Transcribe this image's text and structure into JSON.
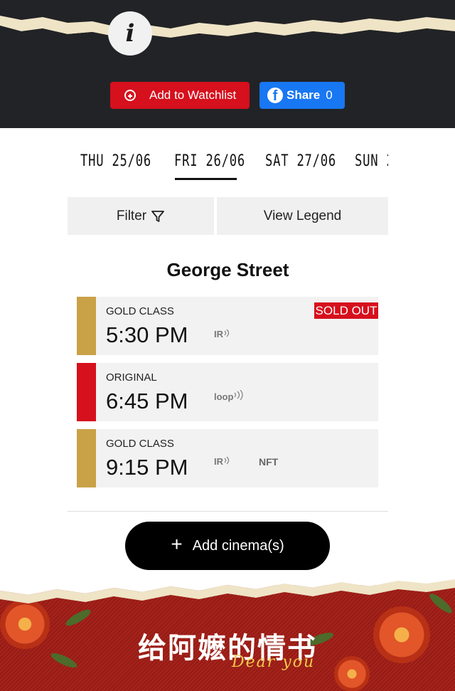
{
  "header": {
    "info_glyph": "i",
    "watchlist_label": "Add to Watchlist",
    "share_label": "Share",
    "share_count": "0"
  },
  "dates": [
    {
      "label": "THU 25/06",
      "selected": false
    },
    {
      "label": "FRI 26/06",
      "selected": true
    },
    {
      "label": "SAT 27/06",
      "selected": false
    },
    {
      "label": "SUN 2",
      "selected": false
    }
  ],
  "controls": {
    "filter_label": "Filter",
    "legend_label": "View Legend"
  },
  "cinema": {
    "name": "George Street",
    "sessions": [
      {
        "class": "GOLD CLASS",
        "time": "5:30 PM",
        "feature": "IR",
        "feature2": "",
        "badge": "SOLD OUT",
        "stripe_color": "#c9a247"
      },
      {
        "class": "ORIGINAL",
        "time": "6:45 PM",
        "feature": "loop",
        "feature2": "",
        "badge": "",
        "stripe_color": "#d6101d"
      },
      {
        "class": "GOLD CLASS",
        "time": "9:15 PM",
        "feature": "IR",
        "feature2": "NFT",
        "badge": "",
        "stripe_color": "#c9a247"
      }
    ]
  },
  "add_cinema": {
    "icon": "+",
    "label": "Add cinema(s)"
  },
  "caption": {
    "chinese": "给阿嬷的情书",
    "english": "Dear you"
  },
  "colors": {
    "accent_red": "#d6101d",
    "facebook_blue": "#1877f2",
    "gold": "#c9a247",
    "header_dark": "#222326",
    "banner_red": "#a21d16"
  },
  "icons": {
    "info": "info-icon",
    "watchlist": "plus-circle-icon",
    "share": "facebook-icon",
    "filter": "funnel-icon",
    "add": "plus-icon",
    "hearing": "assistive-listening-icon"
  }
}
